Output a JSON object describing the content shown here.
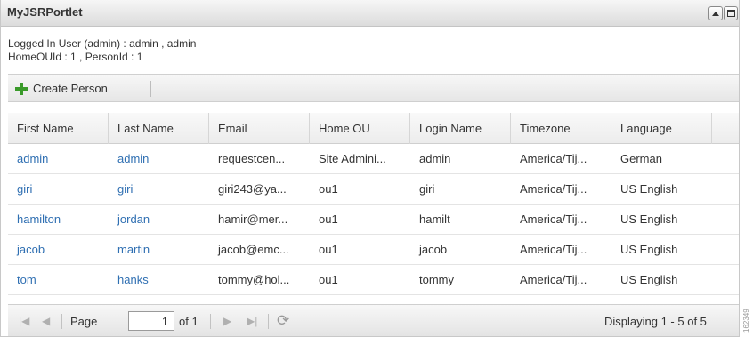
{
  "portlet": {
    "title": "MyJSRPortlet"
  },
  "info": {
    "line1": "Logged In User (admin) : admin , admin",
    "line2": "HomeOUId : 1 , PersonId : 1"
  },
  "toolbar": {
    "create_label": "Create Person",
    "create_icon": "plus-icon"
  },
  "grid": {
    "columns": [
      "First Name",
      "Last Name",
      "Email",
      "Home OU",
      "Login Name",
      "Timezone",
      "Language"
    ],
    "rows": [
      [
        "admin",
        "admin",
        "requestcen...",
        "Site Admini...",
        "admin",
        "America/Tij...",
        "German"
      ],
      [
        "giri",
        "giri",
        "giri243@ya...",
        "ou1",
        "giri",
        "America/Tij...",
        "US English"
      ],
      [
        "hamilton",
        "jordan",
        "hamir@mer...",
        "ou1",
        "hamilt",
        "America/Tij...",
        "US English"
      ],
      [
        "jacob",
        "martin",
        "jacob@emc...",
        "ou1",
        "jacob",
        "America/Tij...",
        "US English"
      ],
      [
        "tom",
        "hanks",
        "tommy@hol...",
        "ou1",
        "tommy",
        "America/Tij...",
        "US English"
      ]
    ],
    "link_color": "#2f6fb2"
  },
  "pager": {
    "page_label": "Page",
    "page_value": "1",
    "of_label": "of 1",
    "status": "Displaying 1 - 5 of 5"
  },
  "side_code": "162349"
}
